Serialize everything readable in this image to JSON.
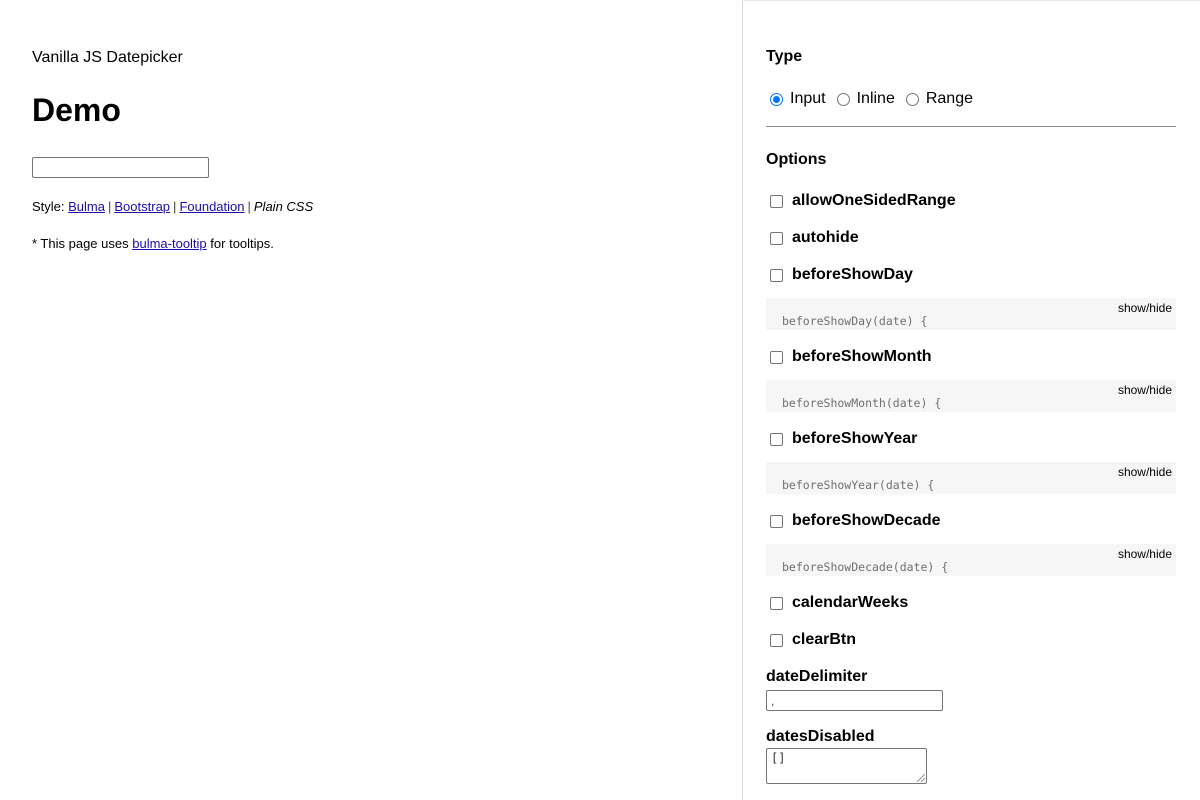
{
  "main": {
    "subtitle": "Vanilla JS Datepicker",
    "title": "Demo",
    "demo_input_value": "",
    "style_prefix": "Style:",
    "styles": {
      "bulma": "Bulma",
      "bootstrap": "Bootstrap",
      "foundation": "Foundation",
      "current": "Plain CSS",
      "separator": "|"
    },
    "note_prefix": "* This page uses",
    "note_link": "bulma-tooltip",
    "note_suffix": "for tooltips."
  },
  "sidebar": {
    "type_heading": "Type",
    "type_options": [
      {
        "label": "Input",
        "selected": true
      },
      {
        "label": "Inline",
        "selected": false
      },
      {
        "label": "Range",
        "selected": false
      }
    ],
    "options_heading": "Options",
    "show_hide_label": "show/hide",
    "options": {
      "allowOneSidedRange": {
        "label": "allowOneSidedRange",
        "checked": false
      },
      "autohide": {
        "label": "autohide",
        "checked": false
      },
      "beforeShowDay": {
        "label": "beforeShowDay",
        "checked": false,
        "code": "beforeShowDay(date) {"
      },
      "beforeShowMonth": {
        "label": "beforeShowMonth",
        "checked": false,
        "code": "beforeShowMonth(date) {"
      },
      "beforeShowYear": {
        "label": "beforeShowYear",
        "checked": false,
        "code": "beforeShowYear(date) {"
      },
      "beforeShowDecade": {
        "label": "beforeShowDecade",
        "checked": false,
        "code": "beforeShowDecade(date) {"
      },
      "calendarWeeks": {
        "label": "calendarWeeks",
        "checked": false
      },
      "clearBtn": {
        "label": "clearBtn",
        "checked": false
      }
    },
    "dateDelimiter": {
      "label": "dateDelimiter",
      "value": ","
    },
    "datesDisabled": {
      "label": "datesDisabled",
      "value": "[]"
    }
  },
  "colors": {
    "accent": "#0075ff",
    "link": "#1a0dab",
    "code_bg": "#f6f6f6"
  }
}
